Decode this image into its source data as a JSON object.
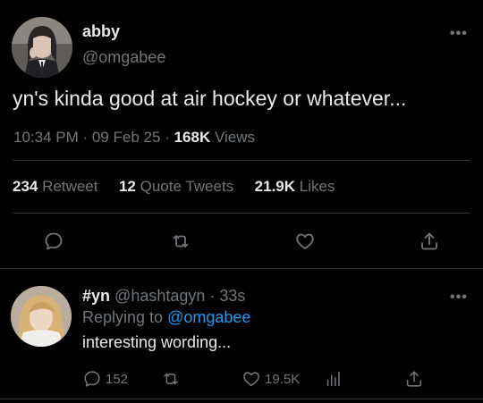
{
  "tweet": {
    "display_name": "abby",
    "handle": "@omgabee",
    "text": "yn's kinda good at air hockey or whatever...",
    "time": "10:34 PM",
    "date": "09 Feb 25",
    "views_count": "168K",
    "views_label": "Views",
    "more_icon": "more-icon"
  },
  "stats": {
    "retweets_count": "234",
    "retweets_label": "Retweet",
    "quotes_count": "12",
    "quotes_label": "Quote Tweets",
    "likes_count": "21.9K",
    "likes_label": "Likes"
  },
  "actions": [
    "reply-icon",
    "retweet-icon",
    "like-icon",
    "share-icon"
  ],
  "reply": {
    "display_name": "#yn",
    "handle": "@hashtagyn",
    "time": "33s",
    "replying_prefix": "Replying to",
    "replying_to": "@omgabee",
    "text": "interesting wording...",
    "reply_count": "152",
    "like_count": "19.5K"
  },
  "colors": {
    "background": "#000000",
    "text": "#e7e9ea",
    "muted": "#71767b",
    "link": "#1d9bf0",
    "divider": "#2f3336"
  }
}
